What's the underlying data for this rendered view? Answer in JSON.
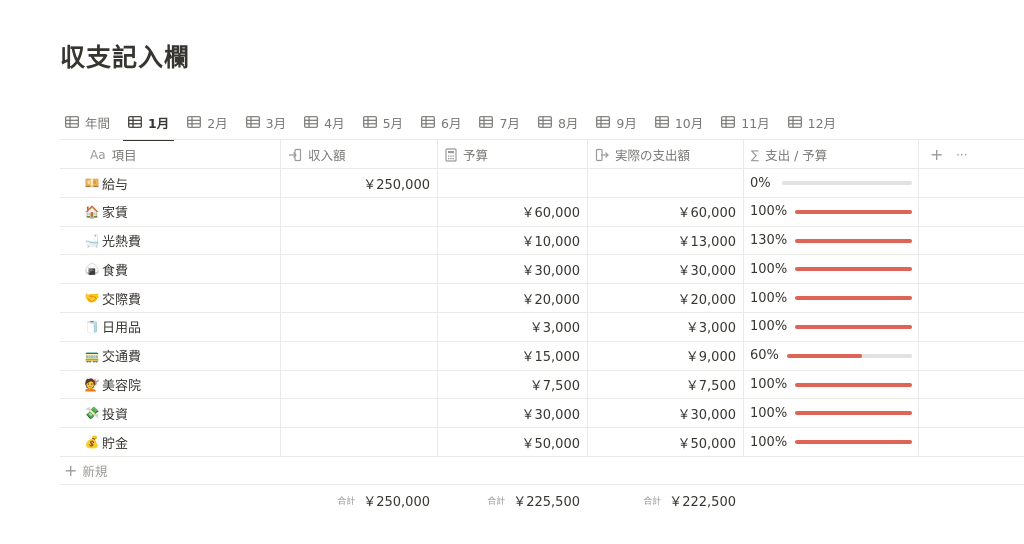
{
  "page": {
    "title": "収支記入欄"
  },
  "tabs": [
    {
      "label": "年間",
      "active": false
    },
    {
      "label": "1月",
      "active": true
    },
    {
      "label": "2月",
      "active": false
    },
    {
      "label": "3月",
      "active": false
    },
    {
      "label": "4月",
      "active": false
    },
    {
      "label": "5月",
      "active": false
    },
    {
      "label": "6月",
      "active": false
    },
    {
      "label": "7月",
      "active": false
    },
    {
      "label": "8月",
      "active": false
    },
    {
      "label": "9月",
      "active": false
    },
    {
      "label": "10月",
      "active": false
    },
    {
      "label": "11月",
      "active": false
    },
    {
      "label": "12月",
      "active": false
    }
  ],
  "columns": {
    "item": {
      "label": "項目",
      "prefix": "Aa"
    },
    "income": {
      "label": "収入額"
    },
    "budget": {
      "label": "予算"
    },
    "actual": {
      "label": "実際の支出額"
    },
    "ratio": {
      "label": "支出 / 予算",
      "prefix": "∑"
    },
    "add": "+",
    "more": "···"
  },
  "rows": [
    {
      "emoji": "💴",
      "name": "給与",
      "income": "￥250,000",
      "budget": "",
      "actual": "",
      "pct": "0%",
      "fill": 0
    },
    {
      "emoji": "🏠",
      "name": "家賃",
      "income": "",
      "budget": "￥60,000",
      "actual": "￥60,000",
      "pct": "100%",
      "fill": 1
    },
    {
      "emoji": "🛁",
      "name": "光熱費",
      "income": "",
      "budget": "￥10,000",
      "actual": "￥13,000",
      "pct": "130%",
      "fill": 1
    },
    {
      "emoji": "🍙",
      "name": "食費",
      "income": "",
      "budget": "￥30,000",
      "actual": "￥30,000",
      "pct": "100%",
      "fill": 1
    },
    {
      "emoji": "🤝",
      "name": "交際費",
      "income": "",
      "budget": "￥20,000",
      "actual": "￥20,000",
      "pct": "100%",
      "fill": 1
    },
    {
      "emoji": "🧻",
      "name": "日用品",
      "income": "",
      "budget": "￥3,000",
      "actual": "￥3,000",
      "pct": "100%",
      "fill": 1
    },
    {
      "emoji": "🚃",
      "name": "交通費",
      "income": "",
      "budget": "￥15,000",
      "actual": "￥9,000",
      "pct": "60%",
      "fill": 0.6
    },
    {
      "emoji": "💇",
      "name": "美容院",
      "income": "",
      "budget": "￥7,500",
      "actual": "￥7,500",
      "pct": "100%",
      "fill": 1
    },
    {
      "emoji": "💸",
      "name": "投資",
      "income": "",
      "budget": "￥30,000",
      "actual": "￥30,000",
      "pct": "100%",
      "fill": 1
    },
    {
      "emoji": "💰",
      "name": "貯金",
      "income": "",
      "budget": "￥50,000",
      "actual": "￥50,000",
      "pct": "100%",
      "fill": 1
    }
  ],
  "new_row": {
    "plus": "+",
    "label": "新規"
  },
  "totals": {
    "label": "合計",
    "income": "￥250,000",
    "budget": "￥225,500",
    "actual": "￥222,500"
  },
  "colors": {
    "progress": "#de6555",
    "track": "#e3e2e0",
    "border": "#e9e9e7"
  }
}
